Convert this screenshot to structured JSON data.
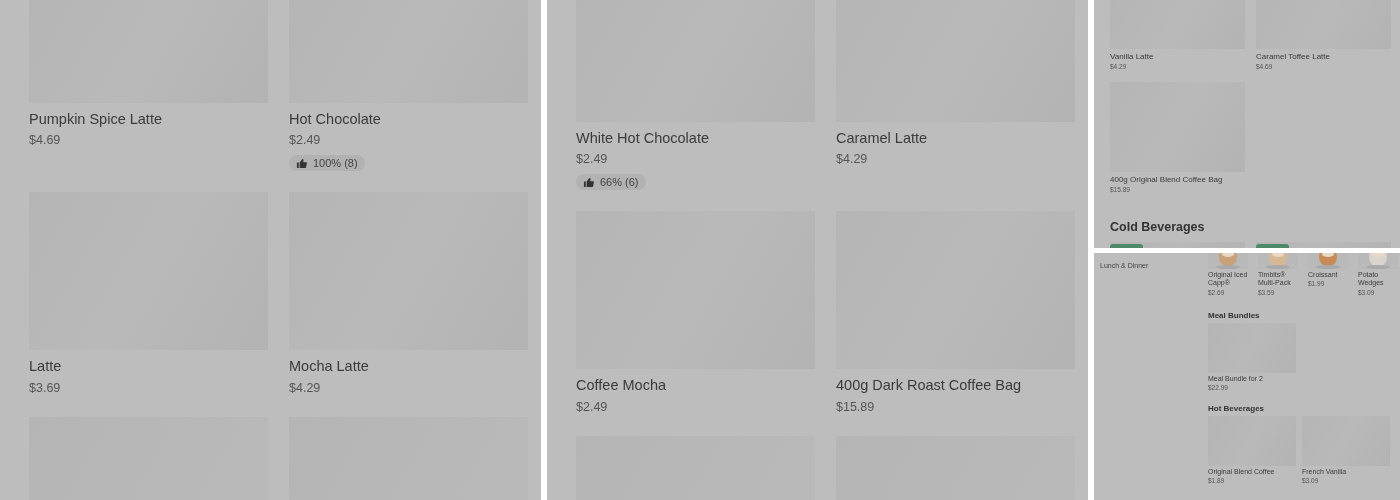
{
  "panels": [
    {
      "kind": "large",
      "sections": [
        {
          "items": [
            {
              "kind": "product",
              "name": "Pumpkin Spice Latte",
              "price": "$4.69"
            },
            {
              "kind": "product",
              "name": "Hot Chocolate",
              "price": "$2.49",
              "rating": "100% (8)"
            },
            {
              "kind": "product",
              "name": "Latte",
              "price": "$3.69"
            },
            {
              "kind": "product",
              "name": "Mocha Latte",
              "price": "$4.29"
            },
            {
              "kind": "cut"
            },
            {
              "kind": "cut"
            }
          ]
        }
      ]
    },
    {
      "kind": "large",
      "sections": [
        {
          "items": [
            {
              "kind": "product",
              "name": "White Hot Chocolate",
              "price": "$2.49",
              "rating": "66% (6)"
            },
            {
              "kind": "product",
              "name": "Caramel Latte",
              "price": "$4.29"
            },
            {
              "kind": "product",
              "name": "Coffee Mocha",
              "price": "$2.49"
            },
            {
              "kind": "product",
              "name": "400g Dark Roast Coffee Bag",
              "price": "$15.89"
            },
            {
              "kind": "cut"
            },
            {
              "kind": "cut"
            }
          ]
        }
      ]
    },
    {
      "kind": "medium",
      "sections": [
        {
          "items": [
            {
              "kind": "product",
              "name": "Vanilla Latte",
              "price": "$4.29"
            },
            {
              "kind": "product",
              "name": "Caramel Toffee Latte",
              "price": "$4.69"
            },
            {
              "kind": "product",
              "name": "400g Original Blend Coffee Bag",
              "price": "$15.89"
            }
          ]
        },
        {
          "heading": "Cold Beverages",
          "items": [
            {
              "kind": "cut",
              "badge": true
            },
            {
              "kind": "cut",
              "badge": true
            }
          ]
        }
      ]
    },
    {
      "kind": "small",
      "sidebar": [
        "Lunch & Dinner"
      ],
      "sections": [
        {
          "items": [
            {
              "name": "Original Iced Capp®",
              "price": "$2.69"
            },
            {
              "name": "Timbits® Multi-Pack",
              "price": "$3.59"
            },
            {
              "name": "Croissant",
              "price": "$1.99"
            },
            {
              "name": "Potato Wedges",
              "price": "$3.09"
            }
          ]
        },
        {
          "heading": "Meal Bundles",
          "items": [
            {
              "kind": "product",
              "name": "Meal Bundle for 2",
              "price": "$22.99"
            }
          ]
        },
        {
          "heading": "Hot Beverages",
          "items": [
            {
              "kind": "product",
              "name": "Original Blend Coffee",
              "price": "$1.89"
            },
            {
              "kind": "product",
              "name": "French Vanilla",
              "price": "$3.09"
            }
          ]
        }
      ]
    }
  ]
}
